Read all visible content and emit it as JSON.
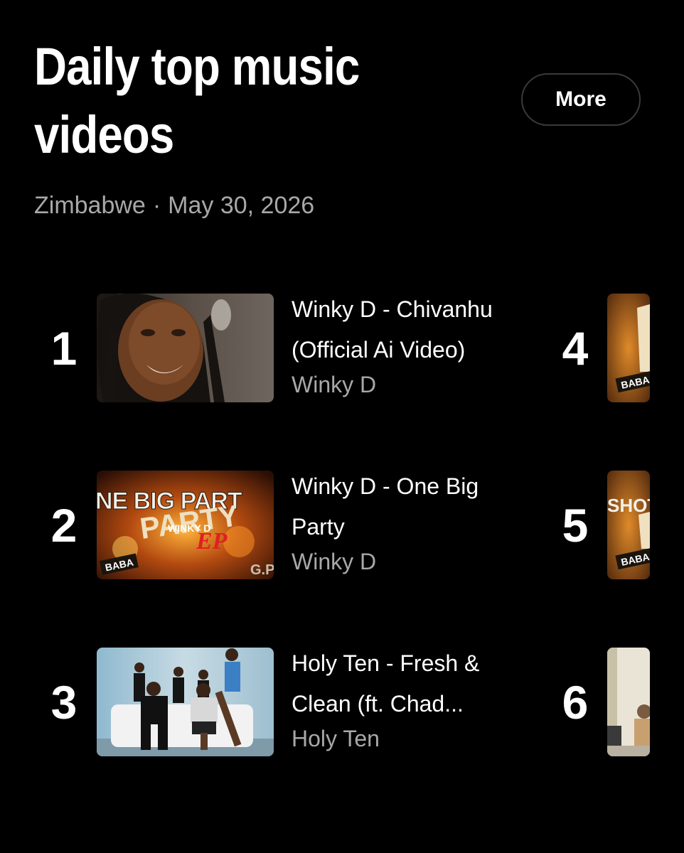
{
  "header": {
    "title": "Daily top music videos",
    "more_label": "More",
    "region": "Zimbabwe",
    "separator": "·",
    "date": "May 30, 2026"
  },
  "videos": [
    {
      "rank": "1",
      "title": "Winky D - Chivanhu (Official Ai Video)",
      "artist": "Winky D"
    },
    {
      "rank": "2",
      "title": "Winky D - One Big Party",
      "artist": "Winky D"
    },
    {
      "rank": "3",
      "title": "Holy Ten - Fresh & Clean (ft. Chad...",
      "artist": "Holy Ten"
    },
    {
      "rank": "4"
    },
    {
      "rank": "5"
    },
    {
      "rank": "6"
    }
  ],
  "thumb_text": {
    "flag": "BABA",
    "album_big": "NE BIG PART",
    "album_party": "PARTY",
    "album_artist": "WINKY D",
    "album_ep": "EP",
    "album_corner": "G.P",
    "shot": "SHOT"
  }
}
